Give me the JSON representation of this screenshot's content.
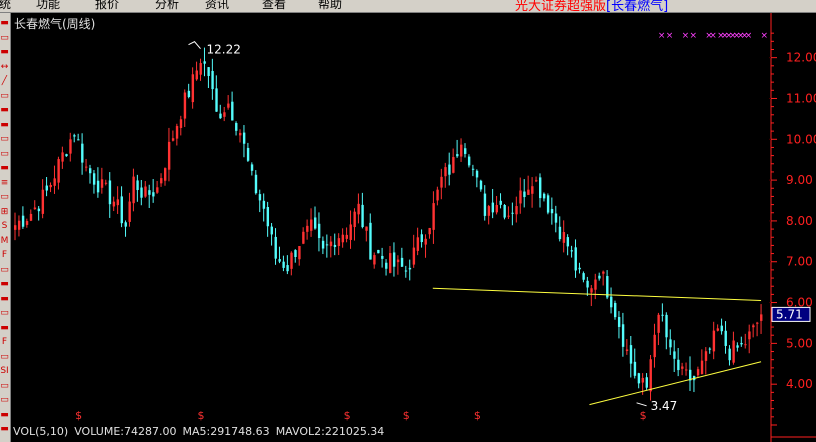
{
  "menu": {
    "items": [
      "统",
      "功能",
      "报价",
      "分析",
      "资讯",
      "查看",
      "帮助"
    ],
    "broker_title": "光大证券超强版",
    "broker_stock": "[长春燃气]"
  },
  "chart_title": "长春燃气(周线)",
  "price_tag": "5.71",
  "annotations": {
    "high": "12.22",
    "low": "3.47",
    "dollar": "$",
    "cross": "×"
  },
  "left_toolbar_icons": [
    "▬",
    "▭",
    "▬",
    "↔",
    "╱",
    "▭",
    "▬",
    "▬",
    "▭",
    "▭",
    "▬",
    "≡",
    "▭",
    "⊞",
    "S",
    "M",
    "F",
    "▭",
    "▬",
    "▬",
    "▭",
    "▬",
    "F",
    "▭",
    "SI",
    "▭",
    "▭",
    "▬",
    "▬"
  ],
  "volume_bar": {
    "label": "VOL(5,10)",
    "volume": "VOLUME:74287.00",
    "ma5": "MA5:291748.63",
    "mavol2": "MAVOL2:221025.34"
  },
  "colors": {
    "up": "#ff3232",
    "down": "#54fcfc",
    "axis": "#ff2020",
    "trendline": "#ffff40",
    "price_tag_bg": "#000080",
    "marker": "#ff40ff"
  },
  "chart_data": {
    "type": "candlestick",
    "title": "长春燃气(周线)",
    "y_ticks": [
      4.0,
      5.0,
      6.0,
      7.0,
      8.0,
      9.0,
      10.0,
      11.0,
      12.0
    ],
    "ylim": [
      3.0,
      12.8
    ],
    "grid": false,
    "period_high": 12.22,
    "period_low": 3.47,
    "last_price": 5.71,
    "trendlines": [
      {
        "name": "upper",
        "from_bar": 0.56,
        "from_price": 6.35,
        "to_bar": 1.0,
        "to_price": 6.05
      },
      {
        "name": "lower",
        "from_bar": 0.77,
        "from_price": 3.5,
        "to_bar": 1.0,
        "to_price": 4.55
      }
    ],
    "anchors": [
      [
        0,
        7.9
      ],
      [
        4,
        8.2
      ],
      [
        8,
        8.7
      ],
      [
        12,
        9.6
      ],
      [
        15,
        10.2
      ],
      [
        18,
        9.3
      ],
      [
        22,
        8.8
      ],
      [
        25,
        8.5
      ],
      [
        28,
        7.9
      ],
      [
        30,
        9.0
      ],
      [
        33,
        8.6
      ],
      [
        36,
        8.8
      ],
      [
        39,
        9.8
      ],
      [
        42,
        10.7
      ],
      [
        45,
        11.4
      ],
      [
        47,
        12.0
      ],
      [
        49,
        11.6
      ],
      [
        51,
        10.6
      ],
      [
        54,
        10.9
      ],
      [
        57,
        10.2
      ],
      [
        60,
        9.0
      ],
      [
        63,
        8.3
      ],
      [
        66,
        7.1
      ],
      [
        69,
        6.9
      ],
      [
        72,
        7.5
      ],
      [
        75,
        7.8
      ],
      [
        78,
        7.2
      ],
      [
        81,
        7.6
      ],
      [
        84,
        7.8
      ],
      [
        87,
        8.3
      ],
      [
        90,
        7.3
      ],
      [
        93,
        7.1
      ],
      [
        96,
        6.9
      ],
      [
        99,
        6.8
      ],
      [
        102,
        7.4
      ],
      [
        105,
        8.0
      ],
      [
        108,
        9.0
      ],
      [
        111,
        9.4
      ],
      [
        113,
        10.1
      ],
      [
        115,
        9.6
      ],
      [
        117,
        8.9
      ],
      [
        119,
        8.3
      ],
      [
        122,
        8.5
      ],
      [
        125,
        8.2
      ],
      [
        128,
        8.6
      ],
      [
        131,
        9.1
      ],
      [
        134,
        8.6
      ],
      [
        137,
        8.0
      ],
      [
        140,
        7.4
      ],
      [
        143,
        6.6
      ],
      [
        145,
        6.3
      ],
      [
        148,
        6.8
      ],
      [
        151,
        6.1
      ],
      [
        153,
        5.5
      ],
      [
        155,
        4.8
      ],
      [
        158,
        4.0
      ],
      [
        160,
        3.9
      ],
      [
        162,
        5.4
      ],
      [
        164,
        5.6
      ],
      [
        166,
        4.7
      ],
      [
        169,
        4.2
      ],
      [
        172,
        4.1
      ],
      [
        175,
        4.6
      ],
      [
        178,
        5.3
      ],
      [
        181,
        4.8
      ],
      [
        184,
        4.9
      ],
      [
        187,
        5.3
      ],
      [
        189,
        5.71
      ]
    ],
    "markers_dollar_bars": [
      16,
      47,
      84,
      99,
      117,
      159
    ],
    "markers_cross_bars": [
      154,
      156,
      160,
      162,
      166,
      167,
      169,
      170,
      171,
      172,
      173,
      174,
      175,
      176,
      180
    ]
  }
}
